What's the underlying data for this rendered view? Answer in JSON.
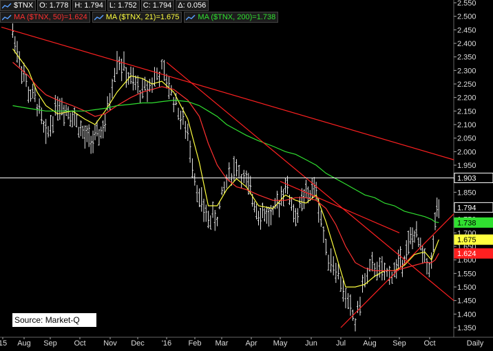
{
  "header": {
    "symbol": "$TNX",
    "open": "O: 1.778",
    "high": "H: 1.794",
    "low": "L: 1.752",
    "close": "C: 1.794",
    "change": "Δ: 0.056"
  },
  "legend": [
    {
      "label": "MA ($TNX, 50)=1.624",
      "color": "#ff3030"
    },
    {
      "label": "MA ($TNX, 21)=1.675",
      "color": "#ffff40"
    },
    {
      "label": "MA ($TNX, 200)=1.738",
      "color": "#30e030"
    }
  ],
  "source": "Source: Market-Q",
  "chart_data": {
    "type": "line",
    "title": "",
    "xlabel": "",
    "ylabel": "",
    "ylim": [
      1.325,
      2.575
    ],
    "y_ticks": [
      "2.550",
      "2.500",
      "2.450",
      "2.400",
      "2.350",
      "2.300",
      "2.250",
      "2.200",
      "2.150",
      "2.100",
      "2.050",
      "2.000",
      "1.950",
      "1.900",
      "1.850",
      "1.800",
      "1.750",
      "1.700",
      "1.650",
      "1.600",
      "1.550",
      "1.500",
      "1.450",
      "1.400",
      "1.350"
    ],
    "x_ticks": [
      "15",
      "Aug",
      "Sep",
      "Oct",
      "Nov",
      "Dec",
      "'16",
      "Feb",
      "Mar",
      "Apr",
      "May",
      "Jun",
      "Jul",
      "Aug",
      "Sep",
      "Oct"
    ],
    "scale_label": "Daily",
    "horizontal_line": {
      "value": 1.903,
      "label": "1.903",
      "color": "#ffffff"
    },
    "price_tags": [
      {
        "value": 1.794,
        "label": "1.794",
        "bg": "#000000",
        "fg": "#ffffff"
      },
      {
        "value": 1.738,
        "label": "1.738",
        "bg": "#30e030",
        "fg": "#000000"
      },
      {
        "value": 1.675,
        "label": "1.675",
        "bg": "#ffff40",
        "fg": "#000000"
      },
      {
        "value": 1.624,
        "label": "1.624",
        "bg": "#ff2020",
        "fg": "#ffffff"
      }
    ],
    "price": [
      {
        "x": "Jul 2015",
        "y": 2.44
      },
      {
        "x": "Aug 2015",
        "y": 2.22
      },
      {
        "x": "Aug 2015",
        "y": 2.18
      },
      {
        "x": "Aug 2015",
        "y": 2.05
      },
      {
        "x": "Sep 2015",
        "y": 2.18
      },
      {
        "x": "Sep 2015",
        "y": 2.14
      },
      {
        "x": "Oct 2015",
        "y": 2.05
      },
      {
        "x": "Oct 2015",
        "y": 2.04
      },
      {
        "x": "Oct 2015",
        "y": 2.1
      },
      {
        "x": "Nov 2015",
        "y": 2.35
      },
      {
        "x": "Nov 2015",
        "y": 2.26
      },
      {
        "x": "Dec 2015",
        "y": 2.22
      },
      {
        "x": "Dec 2015",
        "y": 2.26
      },
      {
        "x": "Dec 2015",
        "y": 2.3
      },
      {
        "x": "Jan 2016",
        "y": 2.2
      },
      {
        "x": "Jan 2016",
        "y": 2.06
      },
      {
        "x": "Feb 2016",
        "y": 1.82
      },
      {
        "x": "Feb 2016",
        "y": 1.75
      },
      {
        "x": "Feb 2016",
        "y": 1.76
      },
      {
        "x": "Mar 2016",
        "y": 1.9
      },
      {
        "x": "Mar 2016",
        "y": 1.95
      },
      {
        "x": "Mar 2016",
        "y": 1.88
      },
      {
        "x": "Apr 2016",
        "y": 1.78
      },
      {
        "x": "Apr 2016",
        "y": 1.76
      },
      {
        "x": "May 2016",
        "y": 1.88
      },
      {
        "x": "May 2016",
        "y": 1.76
      },
      {
        "x": "May 2016",
        "y": 1.84
      },
      {
        "x": "Jun 2016",
        "y": 1.86
      },
      {
        "x": "Jun 2016",
        "y": 1.64
      },
      {
        "x": "Jun 2016",
        "y": 1.57
      },
      {
        "x": "Jul 2016",
        "y": 1.46
      },
      {
        "x": "Jul 2016",
        "y": 1.37
      },
      {
        "x": "Jul 2016",
        "y": 1.53
      },
      {
        "x": "Aug 2016",
        "y": 1.58
      },
      {
        "x": "Aug 2016",
        "y": 1.54
      },
      {
        "x": "Aug 2016",
        "y": 1.56
      },
      {
        "x": "Sep 2016",
        "y": 1.62
      },
      {
        "x": "Sep 2016",
        "y": 1.7
      },
      {
        "x": "Sep 2016",
        "y": 1.6
      },
      {
        "x": "Oct 2016",
        "y": 1.58
      },
      {
        "x": "Oct 2016",
        "y": 1.74
      },
      {
        "x": "Oct 2016",
        "y": 1.794
      }
    ],
    "series": [
      {
        "name": "MA ($TNX, 21)",
        "color": "#ffff40",
        "values": [
          2.38,
          2.3,
          2.22,
          2.17,
          2.14,
          2.15,
          2.12,
          2.1,
          2.15,
          2.22,
          2.28,
          2.27,
          2.25,
          2.26,
          2.22,
          2.12,
          1.96,
          1.8,
          1.8,
          1.86,
          1.9,
          1.87,
          1.8,
          1.79,
          1.84,
          1.82,
          1.81,
          1.84,
          1.74,
          1.62,
          1.5,
          1.5,
          1.51,
          1.54,
          1.56,
          1.56,
          1.58,
          1.62,
          1.63,
          1.6,
          1.64,
          1.675
        ]
      },
      {
        "name": "MA ($TNX, 50)",
        "color": "#ff3030",
        "values": [
          2.33,
          2.28,
          2.24,
          2.21,
          2.19,
          2.17,
          2.15,
          2.13,
          2.14,
          2.17,
          2.2,
          2.22,
          2.23,
          2.24,
          2.23,
          2.19,
          2.13,
          2.03,
          1.95,
          1.9,
          1.87,
          1.86,
          1.84,
          1.82,
          1.82,
          1.83,
          1.83,
          1.82,
          1.79,
          1.73,
          1.65,
          1.59,
          1.57,
          1.56,
          1.56,
          1.56,
          1.57,
          1.58,
          1.59,
          1.59,
          1.6,
          1.624
        ]
      },
      {
        "name": "MA ($TNX, 200)",
        "color": "#30e030",
        "values": [
          2.17,
          2.16,
          2.155,
          2.15,
          2.15,
          2.15,
          2.15,
          2.155,
          2.16,
          2.17,
          2.175,
          2.18,
          2.18,
          2.185,
          2.19,
          2.185,
          2.17,
          2.15,
          2.13,
          2.1,
          2.08,
          2.06,
          2.04,
          2.02,
          2.0,
          1.99,
          1.97,
          1.95,
          1.92,
          1.9,
          1.88,
          1.86,
          1.84,
          1.83,
          1.81,
          1.8,
          1.78,
          1.77,
          1.76,
          1.75,
          1.74,
          1.738
        ]
      }
    ],
    "trendlines": [
      {
        "color": "#ff2020",
        "from": {
          "x": "Jul 2015",
          "y": 2.46
        },
        "to": {
          "x": "Oct 2016",
          "y": 1.97
        }
      },
      {
        "color": "#ff2020",
        "from": {
          "x": "Jan 2016",
          "y": 2.33
        },
        "to": {
          "x": "Oct 2016",
          "y": 1.45
        }
      },
      {
        "color": "#ff2020",
        "from": {
          "x": "Jul 2016",
          "y": 1.35
        },
        "to": {
          "x": "Oct 2016",
          "y": 1.77
        }
      },
      {
        "color": "#ff2020",
        "from": {
          "x": "May 2016",
          "y": 1.89
        },
        "to": {
          "x": "Sep 2016",
          "y": 1.7
        }
      }
    ]
  }
}
